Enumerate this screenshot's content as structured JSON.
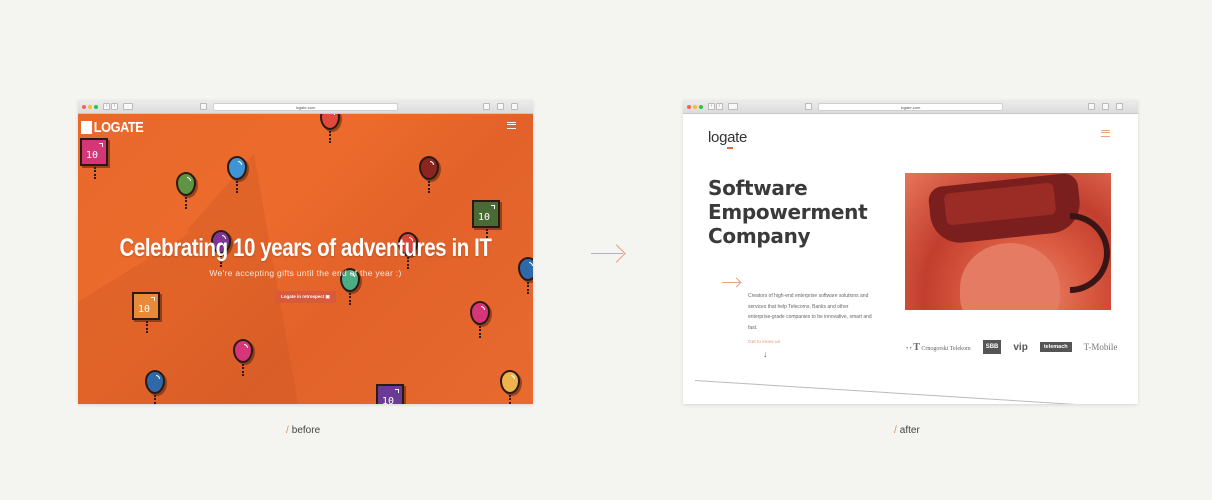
{
  "before": {
    "url": "logate.com",
    "logo": "LOGATE",
    "headline": "Celebrating 10 years of adventures in IT",
    "subheadline": "We're accepting gifts until the end of the year :)",
    "cta": "Logate in retrospect",
    "box_label": "10",
    "caption": "before"
  },
  "after": {
    "url": "logate.com",
    "logo": "logate",
    "title_lines": [
      "Software",
      "Empowerment",
      "Company"
    ],
    "description": "Creators of high-end enterprise software solutions and services that help Telecoms, Banks and other enterprise-grade companies to be innovative, smart and fast.",
    "cta": "Get to know us",
    "clients": [
      "Crnogorski Telekom",
      "SBB",
      "vip",
      "telemach",
      "T-Mobile"
    ],
    "caption": "after"
  },
  "caption_prefix": "/",
  "colors": {
    "accent": "#e86a3c",
    "orange_bg": "#e8692e",
    "page_bg": "#f4f4f0"
  }
}
